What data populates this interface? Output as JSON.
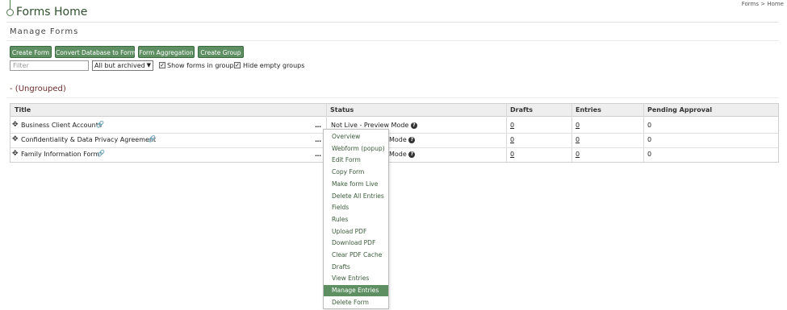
{
  "header": {
    "title": "Forms Home",
    "breadcrumb": "Forms > Home"
  },
  "section": {
    "title": "Manage Forms"
  },
  "buttons": {
    "create_form": "Create Form",
    "convert_db": "Convert Database to Form",
    "aggregation": "Form Aggregation",
    "create_group": "Create Group"
  },
  "filters": {
    "filter_placeholder": "Filter",
    "select_value": "All but archived",
    "show_in_groups": "Show forms in groups",
    "hide_empty": "Hide empty groups"
  },
  "group": {
    "title": "-   (Ungrouped)"
  },
  "table": {
    "headers": [
      "Title",
      "Status",
      "Drafts",
      "Entries",
      "Pending Approval"
    ],
    "rows": [
      {
        "title": "Business Client Accounts",
        "status": "Not Live - Preview Mode",
        "drafts": "0",
        "entries": "0",
        "pending": "0"
      },
      {
        "title": "Confidentiality & Data Privacy Agreement",
        "status": "Mode",
        "drafts": "0",
        "entries": "0",
        "pending": "0"
      },
      {
        "title": "Family Information Form",
        "status": "Mode",
        "drafts": "0",
        "entries": "0",
        "pending": "0"
      }
    ],
    "dots": "...",
    "move_glyph": "✥",
    "link_glyph": "🔗",
    "help_glyph": "?"
  },
  "menu": {
    "items": [
      "Overview",
      "Webform (popup)",
      "Edit Form",
      "Copy Form",
      "Make form Live",
      "Delete All Entries",
      "Fields",
      "Rules",
      "Upload PDF",
      "Download PDF",
      "Clear PDF Cache",
      "Drafts",
      "View Entries",
      "Manage Entries",
      "Delete Form"
    ],
    "active": "Manage Entries"
  },
  "colors": {
    "button": "#5e8f62",
    "active_menu": "#5e8f62",
    "title": "#2f4f2f",
    "group": "#6b2d2d"
  }
}
